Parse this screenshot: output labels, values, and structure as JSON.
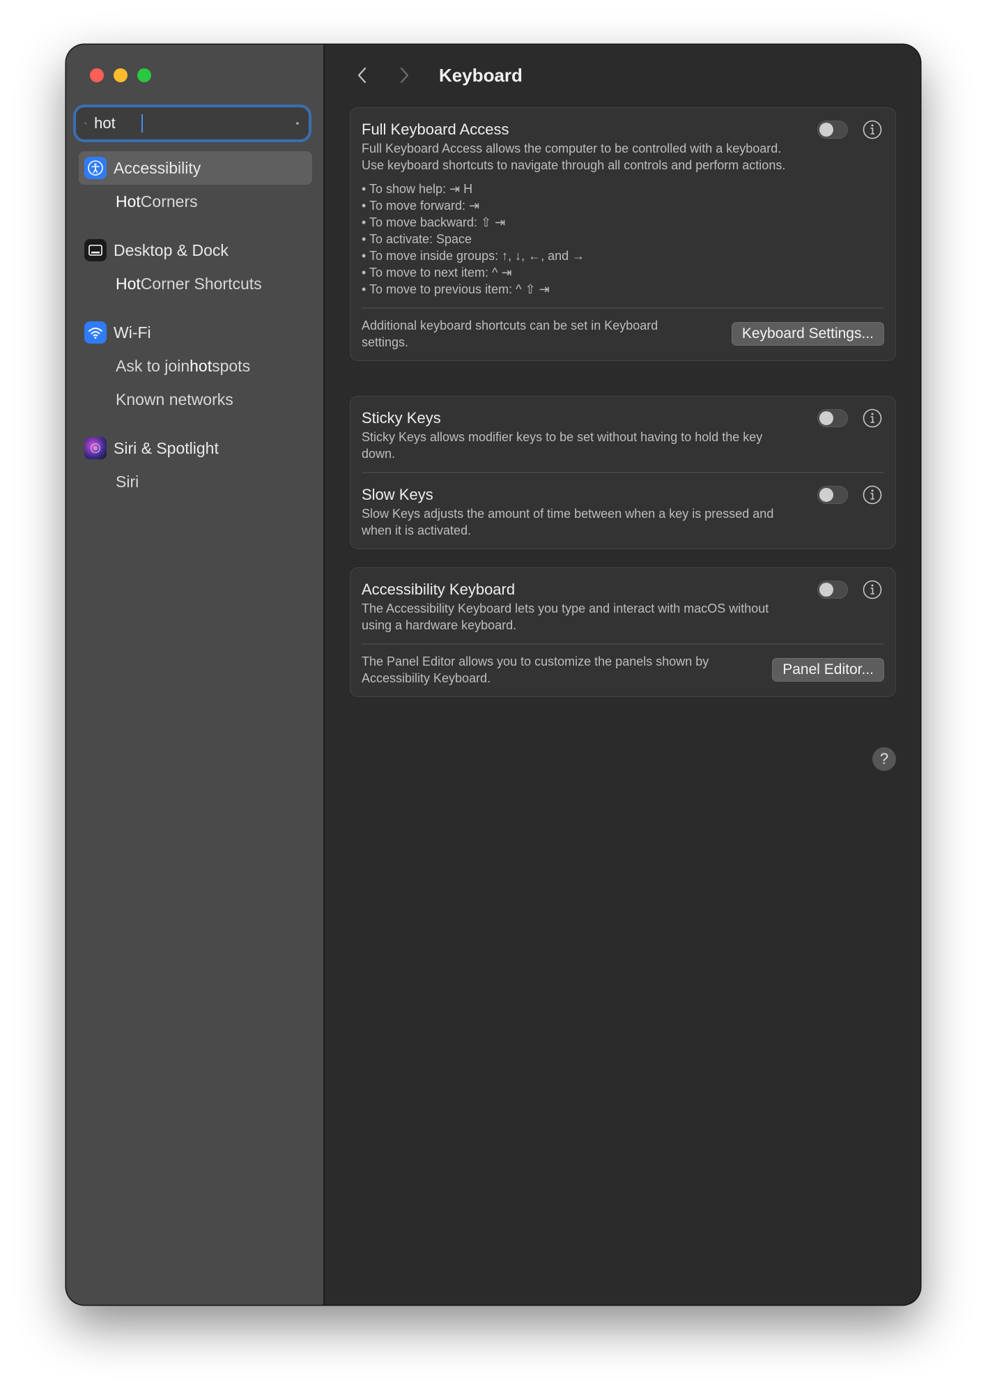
{
  "sidebar": {
    "search": {
      "value": "hot"
    },
    "results": [
      {
        "label": "Accessibility",
        "icon": "accessibility-icon",
        "selected": true,
        "subs": [
          {
            "pre": "",
            "hit": "Hot",
            "post": " Corners"
          }
        ]
      },
      {
        "label": "Desktop & Dock",
        "icon": "desktop-dock-icon",
        "selected": false,
        "subs": [
          {
            "pre": "",
            "hit": "Hot",
            "post": " Corner Shortcuts"
          }
        ]
      },
      {
        "label": "Wi-Fi",
        "icon": "wifi-icon",
        "selected": false,
        "subs": [
          {
            "pre": "Ask to join ",
            "hit": "hot",
            "post": "spots"
          },
          {
            "pre": "Known networks",
            "hit": "",
            "post": ""
          }
        ]
      },
      {
        "label": "Siri & Spotlight",
        "icon": "siri-icon",
        "selected": false,
        "subs": [
          {
            "pre": "Siri",
            "hit": "",
            "post": ""
          }
        ]
      }
    ]
  },
  "toolbar": {
    "title": "Keyboard"
  },
  "full_keyboard_access": {
    "title": "Full Keyboard Access",
    "desc": "Full Keyboard Access allows the computer to be controlled with a keyboard. Use keyboard shortcuts to navigate through all controls and perform actions.",
    "bullets": [
      "To show help: ⇥ H",
      "To move forward: ⇥",
      "To move backward: ⇧ ⇥",
      "To activate: Space",
      "To move inside groups: ↑, ↓, ←, and →",
      "To move to next item: ^ ⇥",
      "To move to previous item: ^ ⇧ ⇥"
    ],
    "footer_text": "Additional keyboard shortcuts can be set in Keyboard settings.",
    "button": "Keyboard Settings...",
    "enabled": false
  },
  "sticky_keys": {
    "title": "Sticky Keys",
    "desc": "Sticky Keys allows modifier keys to be set without having to hold the key down.",
    "enabled": false
  },
  "slow_keys": {
    "title": "Slow Keys",
    "desc": "Slow Keys adjusts the amount of time between when a key is pressed and when it is activated.",
    "enabled": false
  },
  "accessibility_keyboard": {
    "title": "Accessibility Keyboard",
    "desc": "The Accessibility Keyboard lets you type and interact with macOS without using a hardware keyboard.",
    "footer_text": "The Panel Editor allows you to customize the panels shown by Accessibility Keyboard.",
    "button": "Panel Editor...",
    "enabled": false
  },
  "help": {
    "label": "?"
  },
  "colors": {
    "accent": "#3a6fb0",
    "sidebar_bg": "#4a4a4a",
    "content_bg": "#2b2b2b"
  }
}
